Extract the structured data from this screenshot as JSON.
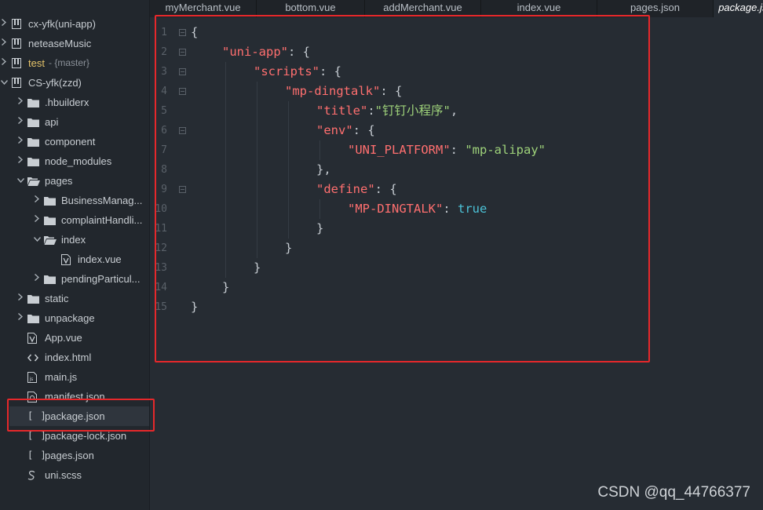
{
  "sidebar": {
    "items": [
      {
        "label": "cx-yfk(uni-app)",
        "depth": 0,
        "arrow": "right",
        "icon": "project-icon"
      },
      {
        "label": "neteaseMusic",
        "depth": 0,
        "arrow": "right",
        "icon": "project-icon"
      },
      {
        "label": "test",
        "suffix": "- {master}",
        "depth": 0,
        "arrow": "right",
        "icon": "project-icon",
        "highlight": "#e6c46a"
      },
      {
        "label": "CS-yfk(zzd)",
        "depth": 0,
        "arrow": "down",
        "icon": "project-icon"
      },
      {
        "label": ".hbuilderx",
        "depth": 1,
        "arrow": "right",
        "icon": "folder-icon"
      },
      {
        "label": "api",
        "depth": 1,
        "arrow": "right",
        "icon": "folder-icon"
      },
      {
        "label": "component",
        "depth": 1,
        "arrow": "right",
        "icon": "folder-icon"
      },
      {
        "label": "node_modules",
        "depth": 1,
        "arrow": "right",
        "icon": "folder-icon"
      },
      {
        "label": "pages",
        "depth": 1,
        "arrow": "down",
        "icon": "folder-open-icon"
      },
      {
        "label": "BusinessManag...",
        "depth": 2,
        "arrow": "right",
        "icon": "folder-icon"
      },
      {
        "label": "complaintHandli...",
        "depth": 2,
        "arrow": "right",
        "icon": "folder-icon"
      },
      {
        "label": "index",
        "depth": 2,
        "arrow": "down",
        "icon": "folder-open-icon"
      },
      {
        "label": "index.vue",
        "depth": 3,
        "arrow": "",
        "icon": "vue-file-icon"
      },
      {
        "label": "pendingParticul...",
        "depth": 2,
        "arrow": "right",
        "icon": "folder-icon"
      },
      {
        "label": "static",
        "depth": 1,
        "arrow": "right",
        "icon": "folder-icon"
      },
      {
        "label": "unpackage",
        "depth": 1,
        "arrow": "right",
        "icon": "folder-icon"
      },
      {
        "label": "App.vue",
        "depth": 1,
        "arrow": "",
        "icon": "vue-file-icon"
      },
      {
        "label": "index.html",
        "depth": 1,
        "arrow": "",
        "icon": "html-file-icon"
      },
      {
        "label": "main.js",
        "depth": 1,
        "arrow": "",
        "icon": "js-file-icon"
      },
      {
        "label": "manifest.json",
        "depth": 1,
        "arrow": "",
        "icon": "manifest-file-icon"
      },
      {
        "label": "package.json",
        "depth": 1,
        "arrow": "",
        "icon": "json-file-icon",
        "selected": true
      },
      {
        "label": "package-lock.json",
        "depth": 1,
        "arrow": "",
        "icon": "json-file-icon"
      },
      {
        "label": "pages.json",
        "depth": 1,
        "arrow": "",
        "icon": "json-file-icon"
      },
      {
        "label": "uni.scss",
        "depth": 1,
        "arrow": "",
        "icon": "scss-file-icon"
      }
    ]
  },
  "tabs": [
    {
      "label": "myMerchant.vue",
      "active": false
    },
    {
      "label": "bottom.vue",
      "active": false
    },
    {
      "label": "addMerchant.vue",
      "active": false
    },
    {
      "label": "index.vue",
      "active": false
    },
    {
      "label": "pages.json",
      "active": false
    },
    {
      "label": "package.json",
      "active": true
    }
  ],
  "editor": {
    "lines": [
      {
        "n": "1",
        "fold": true,
        "indent": 0,
        "tokens": [
          {
            "t": "{",
            "c": "punc"
          }
        ]
      },
      {
        "n": "2",
        "fold": true,
        "indent": 1,
        "tokens": [
          {
            "t": "\"uni-app\"",
            "c": "key"
          },
          {
            "t": ": {",
            "c": "punc"
          }
        ]
      },
      {
        "n": "3",
        "fold": true,
        "indent": 2,
        "tokens": [
          {
            "t": "\"scripts\"",
            "c": "key"
          },
          {
            "t": ": {",
            "c": "punc"
          }
        ]
      },
      {
        "n": "4",
        "fold": true,
        "indent": 3,
        "tokens": [
          {
            "t": "\"mp-dingtalk\"",
            "c": "key"
          },
          {
            "t": ": {",
            "c": "punc"
          }
        ]
      },
      {
        "n": "5",
        "fold": false,
        "indent": 4,
        "tokens": [
          {
            "t": "\"title\"",
            "c": "key"
          },
          {
            "t": ":",
            "c": "punc"
          },
          {
            "t": "\"钉钉小程序\"",
            "c": "str"
          },
          {
            "t": ",",
            "c": "punc"
          }
        ]
      },
      {
        "n": "6",
        "fold": true,
        "indent": 4,
        "tokens": [
          {
            "t": "\"env\"",
            "c": "key"
          },
          {
            "t": ": {",
            "c": "punc"
          }
        ]
      },
      {
        "n": "7",
        "fold": false,
        "indent": 5,
        "tokens": [
          {
            "t": "\"UNI_PLATFORM\"",
            "c": "key"
          },
          {
            "t": ": ",
            "c": "punc"
          },
          {
            "t": "\"mp-alipay\"",
            "c": "str"
          }
        ]
      },
      {
        "n": "8",
        "fold": false,
        "indent": 4,
        "tokens": [
          {
            "t": "},",
            "c": "punc"
          }
        ]
      },
      {
        "n": "9",
        "fold": true,
        "indent": 4,
        "tokens": [
          {
            "t": "\"define\"",
            "c": "key"
          },
          {
            "t": ": {",
            "c": "punc"
          }
        ]
      },
      {
        "n": "10",
        "fold": false,
        "indent": 5,
        "tokens": [
          {
            "t": "\"MP-DINGTALK\"",
            "c": "key"
          },
          {
            "t": ": ",
            "c": "punc"
          },
          {
            "t": "true",
            "c": "bool"
          }
        ]
      },
      {
        "n": "11",
        "fold": false,
        "indent": 4,
        "tokens": [
          {
            "t": "}",
            "c": "punc"
          }
        ]
      },
      {
        "n": "12",
        "fold": false,
        "indent": 3,
        "tokens": [
          {
            "t": "}",
            "c": "punc"
          }
        ]
      },
      {
        "n": "13",
        "fold": false,
        "indent": 2,
        "tokens": [
          {
            "t": "}",
            "c": "punc"
          }
        ]
      },
      {
        "n": "14",
        "fold": false,
        "indent": 1,
        "tokens": [
          {
            "t": "}",
            "c": "punc"
          }
        ]
      },
      {
        "n": "15",
        "fold": false,
        "indent": 0,
        "tokens": [
          {
            "t": "}",
            "c": "punc"
          }
        ]
      }
    ]
  },
  "watermark": "CSDN @qq_44766377",
  "colors": {
    "highlight_box": "#e6282b",
    "key": "#ff6f6f",
    "string": "#9ed27a",
    "boolean": "#4cc3d8"
  }
}
